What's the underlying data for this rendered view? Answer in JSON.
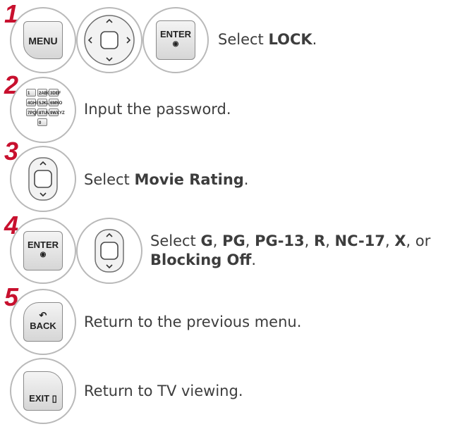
{
  "steps": [
    {
      "number": "1",
      "menu_label": "MENU",
      "enter_label": "ENTER",
      "text_prefix": "Select ",
      "text_bold": "LOCK",
      "text_suffix": "."
    },
    {
      "number": "2",
      "text": "Input the password."
    },
    {
      "number": "3",
      "text_prefix": "Select ",
      "text_bold": "Movie Rating",
      "text_suffix": "."
    },
    {
      "number": "4",
      "enter_label": "ENTER",
      "line1_prefix": "Select ",
      "ratings": [
        "G",
        "PG",
        "PG-13",
        "R",
        "NC-17",
        "X"
      ],
      "sep": ", ",
      "or": ", or",
      "line2_bold": "Blocking Off",
      "line2_suffix": "."
    },
    {
      "number": "5",
      "back_label": "BACK",
      "text": "Return to the previous menu."
    },
    {
      "exit_label": "EXIT",
      "text": "Return to TV viewing."
    }
  ],
  "keypad": [
    "1",
    "2ABC",
    "3DEF",
    "4GHI",
    "5JKL",
    "6MNO",
    "7PQRS",
    "8TUV",
    "9WXYZ",
    "0"
  ]
}
